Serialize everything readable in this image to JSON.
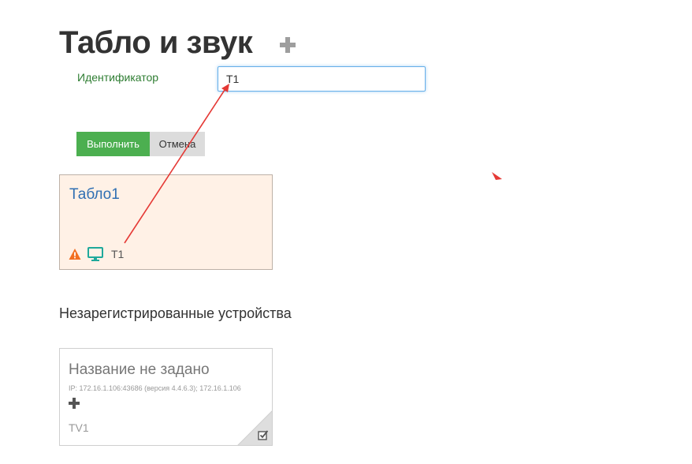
{
  "page": {
    "title": "Табло и звук"
  },
  "form": {
    "id_label": "Идентификатор",
    "id_value": "T1",
    "run_label": "Выполнить",
    "cancel_label": "Отмена"
  },
  "device_card": {
    "title": "Табло1",
    "status_icons": [
      "warning-icon",
      "monitor-icon"
    ],
    "device_id": "T1"
  },
  "unregistered": {
    "heading": "Незарегистрированные устройства",
    "card": {
      "title": "Название не задано",
      "ip_info": "IP:  172.16.1.106:43686 (версия 4.4.6.3); 172.16.1.106",
      "name": "TV1",
      "icons": [
        "plus-icon",
        "checkbox-edit-icon"
      ]
    }
  },
  "colors": {
    "accent_green": "#4caf50",
    "label_green": "#2e7d32",
    "link_blue": "#2f6fb3",
    "card_bg": "#fff1e6",
    "warning": "#f26f21",
    "monitor": "#1fa99b",
    "annotation_red": "#e53935"
  }
}
